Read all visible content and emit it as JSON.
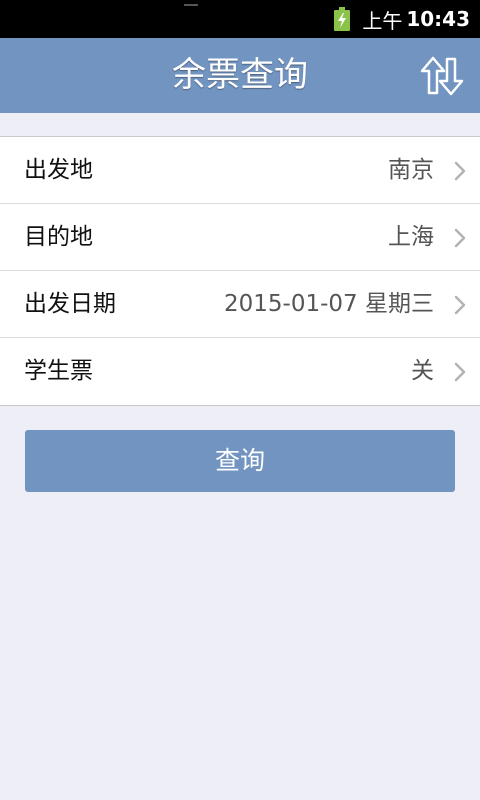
{
  "status_bar": {
    "ampm": "上午",
    "time": "10:43",
    "battery_icon": "battery-charging-icon",
    "battery_color": "#8bc34a"
  },
  "header": {
    "title": "余票查询",
    "swap_icon": "swap-arrows-icon",
    "background": "#7294c1"
  },
  "form": {
    "rows": [
      {
        "label": "出发地",
        "value": "南京"
      },
      {
        "label": "目的地",
        "value": "上海"
      },
      {
        "label": "出发日期",
        "value": "2015-01-07 星期三"
      },
      {
        "label": "学生票",
        "value": "关"
      }
    ]
  },
  "query_button": {
    "label": "查询"
  }
}
